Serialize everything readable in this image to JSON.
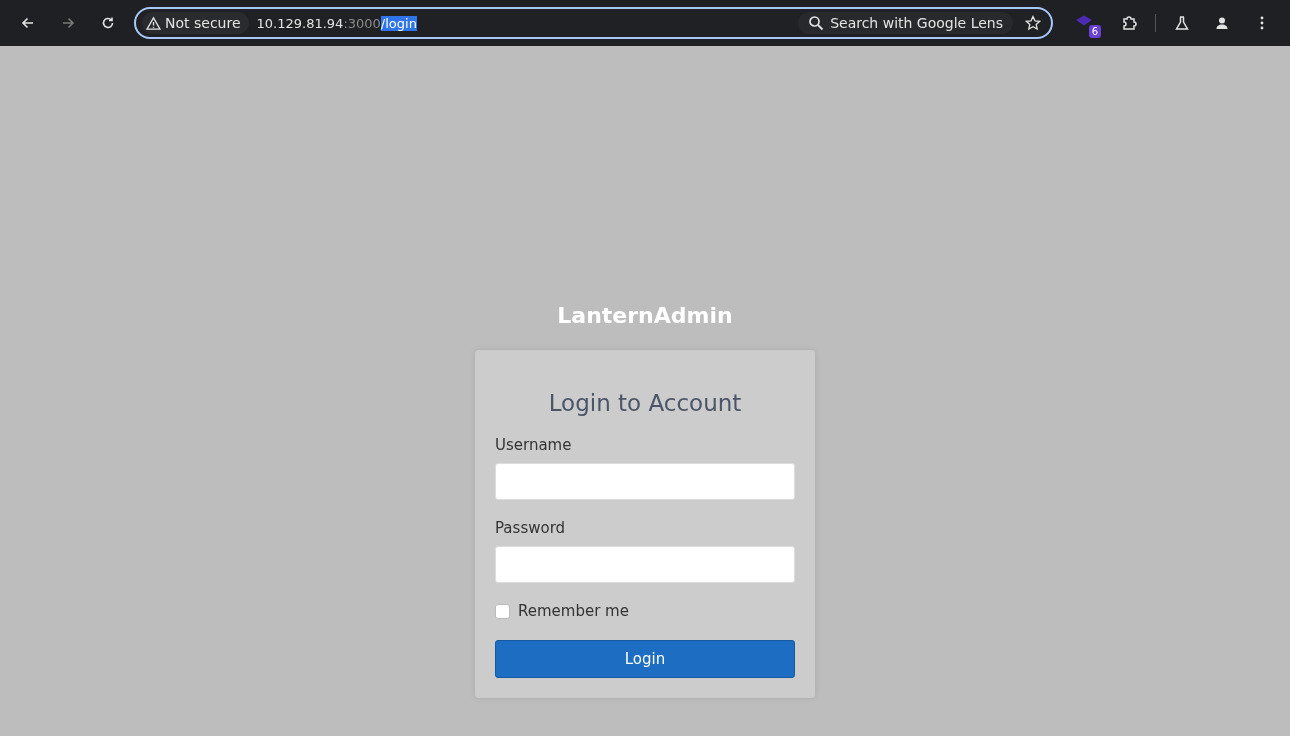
{
  "browser": {
    "security_label": "Not secure",
    "url_parts": [
      {
        "text": "10.129.81.94",
        "kind": "host"
      },
      {
        "text": ":3000",
        "kind": "port"
      },
      {
        "text": "/login",
        "kind": "selected"
      }
    ],
    "lens_label": "Search with Google Lens",
    "extension_badge": "6"
  },
  "page": {
    "brand": "LanternAdmin",
    "heading": "Login to Account",
    "fields": [
      {
        "label": "Username"
      },
      {
        "label": "Password"
      }
    ],
    "remember": {
      "label": "Remember me",
      "checked": false
    },
    "submit": "Login"
  }
}
